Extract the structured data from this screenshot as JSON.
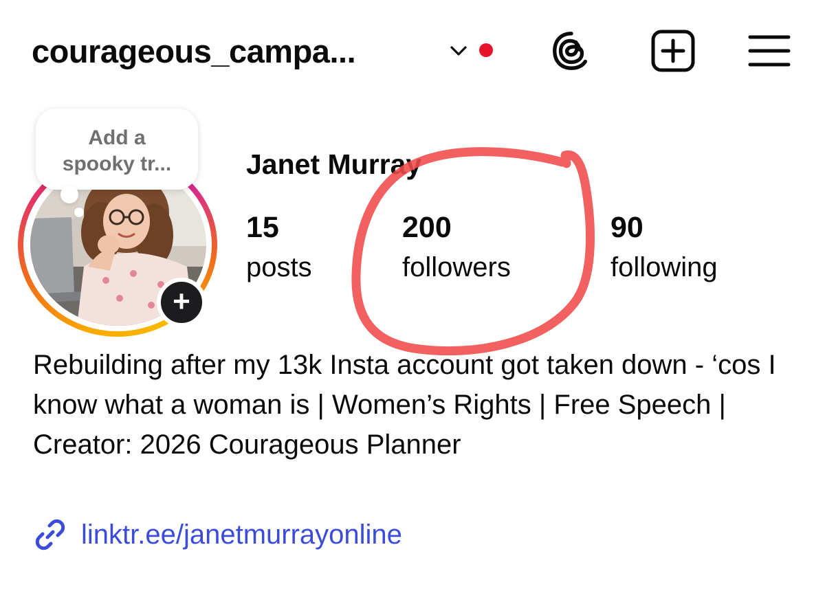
{
  "header": {
    "username": "courageous_campa...",
    "chevron_icon": "chevron-down-icon",
    "notification_dot_color": "#e8132a",
    "icons": [
      "threads-icon",
      "create-post-icon",
      "hamburger-menu-icon"
    ]
  },
  "note": {
    "line1": "Add a",
    "line2": "spooky tr..."
  },
  "profile": {
    "display_name": "Janet Murray",
    "avatar_icon": "profile-photo",
    "add_story_label": "+"
  },
  "stats": {
    "posts": {
      "count": "15",
      "label": "posts"
    },
    "followers": {
      "count": "200",
      "label": "followers"
    },
    "following": {
      "count": "90",
      "label": "following"
    }
  },
  "annotation": {
    "color": "#f04a4a"
  },
  "bio": {
    "text": "Rebuilding after my 13k Insta account got taken down - ‘cos I know what a woman is | Women’s Rights | Free Speech | Creator: 2026 Courageous Planner"
  },
  "link": {
    "icon": "link-icon",
    "text": "linktr.ee/janetmurrayonline",
    "color": "#3b4cdb"
  }
}
